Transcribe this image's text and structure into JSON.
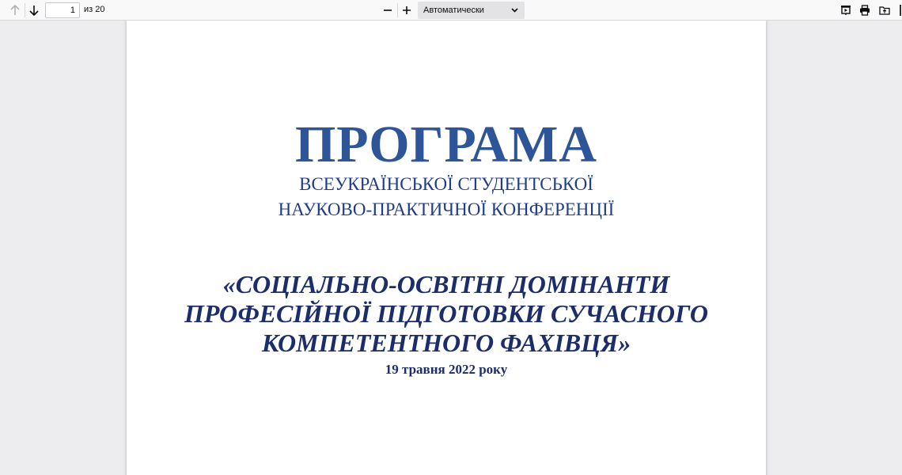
{
  "toolbar": {
    "page_number": "1",
    "page_count": "из 20",
    "zoom_value": "Автоматически",
    "icons": {
      "prev": "arrow-up-icon",
      "next": "arrow-down-icon",
      "zoom_out": "minus-icon",
      "zoom_in": "plus-icon",
      "presentation": "presentation-icon",
      "print": "print-icon",
      "open": "open-file-icon"
    }
  },
  "document": {
    "title": "ПРОГРАМА",
    "subtitle_line1": "ВСЕУКРАЇНСЬКОЇ СТУДЕНТСЬКОЇ",
    "subtitle_line2": "НАУКОВО-ПРАКТИЧНОЇ КОНФЕРЕНЦІЇ",
    "theme_line1": "«СОЦІАЛЬНО-ОСВІТНІ ДОМІНАНТИ",
    "theme_line2": "ПРОФЕСІЙНОЇ ПІДГОТОВКИ СУЧАСНОГО",
    "theme_line3": "КОМПЕТЕНТНОГО ФАХІВЦЯ»",
    "date": "19 травня 2022 року"
  },
  "colors": {
    "title": "#2e5597",
    "subtitle": "#1f3c8a",
    "theme": "#1b2d6b",
    "toolbar_bg": "#f9f9fa",
    "viewer_bg": "#ededf0"
  }
}
